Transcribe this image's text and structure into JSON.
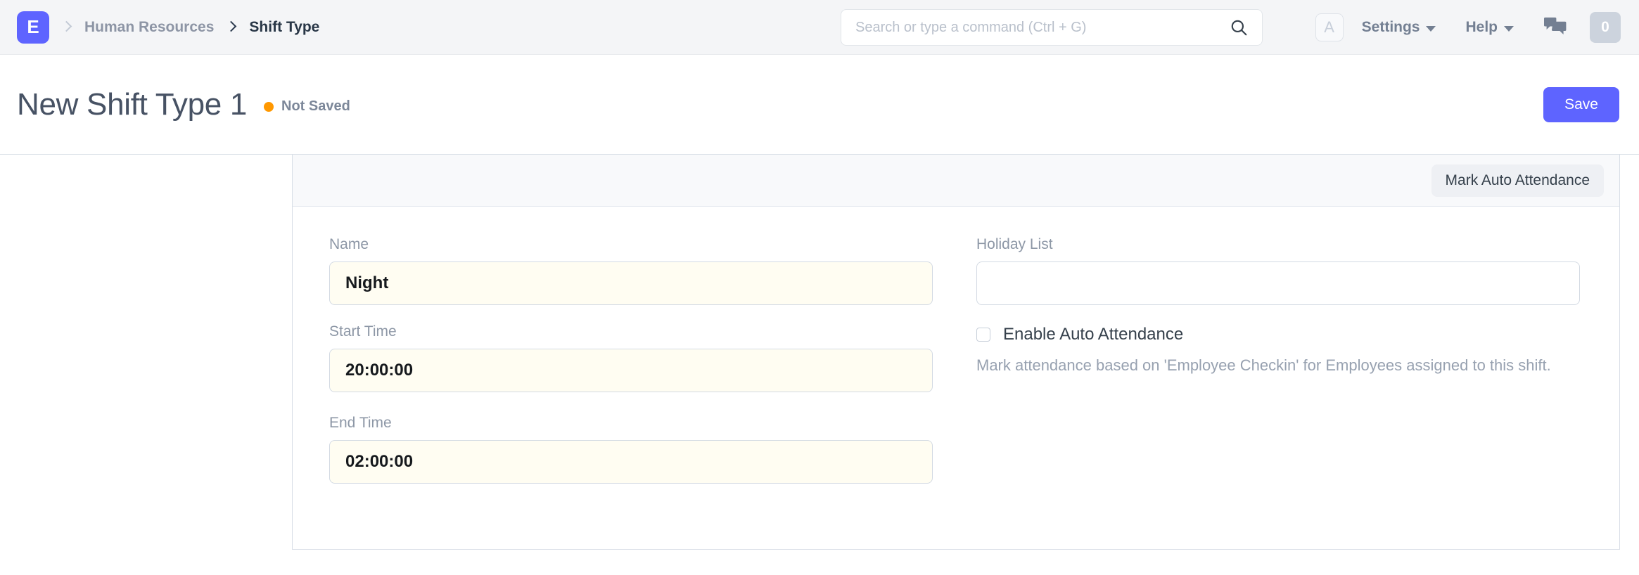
{
  "navbar": {
    "logo_letter": "E",
    "breadcrumbs": [
      {
        "label": "Human Resources",
        "active": false
      },
      {
        "label": "Shift Type",
        "active": true
      }
    ],
    "search": {
      "placeholder": "Search or type a command (Ctrl + G)",
      "value": "",
      "icon": "search-icon"
    },
    "avatar_letter": "A",
    "menus": [
      {
        "label": "Settings"
      },
      {
        "label": "Help"
      }
    ],
    "chat_icon": "comments-icon",
    "notification_count": "0"
  },
  "page_header": {
    "title": "New Shift Type 1",
    "status_label": "Not Saved",
    "status_color": "#ff9800",
    "save_label": "Save",
    "save_color": "#5e64ff"
  },
  "form": {
    "toolbar": {
      "mark_auto_attendance_label": "Mark Auto Attendance"
    },
    "left_column": [
      {
        "label": "Name",
        "value": "Night"
      },
      {
        "label": "Start Time",
        "value": "20:00:00"
      },
      {
        "label": "End Time",
        "value": "02:00:00"
      }
    ],
    "right_column": {
      "holiday_list": {
        "label": "Holiday List",
        "value": ""
      },
      "enable_auto_attendance": {
        "label": "Enable Auto Attendance",
        "checked": false,
        "help": "Mark attendance based on 'Employee Checkin' for Employees assigned to this shift."
      }
    }
  }
}
